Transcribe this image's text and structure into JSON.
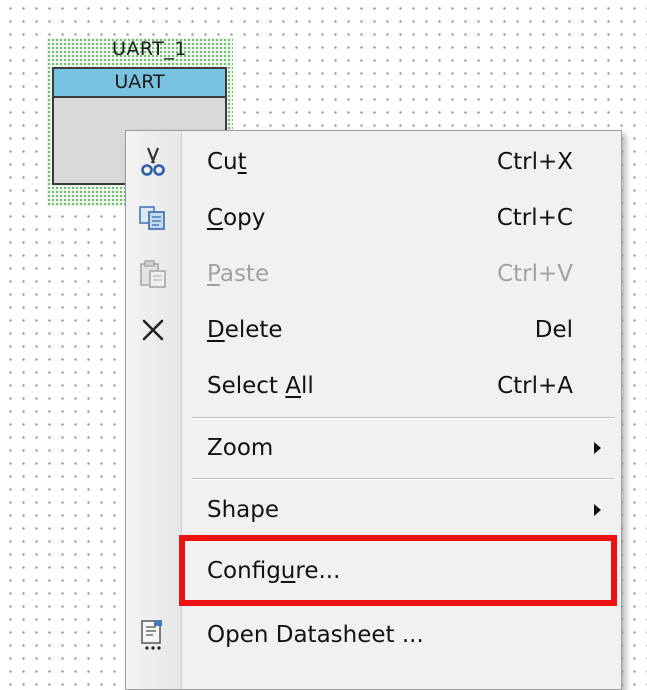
{
  "canvas": {
    "instance_name": "UART_1",
    "component_title": "UART"
  },
  "context_menu": {
    "items": [
      {
        "label_parts": [
          "Cu",
          "t",
          ""
        ],
        "shortcut": "Ctrl+X",
        "icon": "scissors-icon",
        "enabled": true
      },
      {
        "label_parts": [
          "",
          "C",
          "opy"
        ],
        "shortcut": "Ctrl+C",
        "icon": "copy-icon",
        "enabled": true
      },
      {
        "label_parts": [
          "",
          "P",
          "aste"
        ],
        "shortcut": "Ctrl+V",
        "icon": "paste-icon",
        "enabled": false
      },
      {
        "label_parts": [
          "",
          "D",
          "elete"
        ],
        "shortcut": "Del",
        "icon": "delete-x-icon",
        "enabled": true
      },
      {
        "label_parts": [
          "Select ",
          "A",
          "ll"
        ],
        "shortcut": "Ctrl+A",
        "icon": "",
        "enabled": true
      },
      {
        "label": "Zoom",
        "submenu": true
      },
      {
        "label": "Shape",
        "submenu": true
      },
      {
        "label_parts": [
          "Config",
          "u",
          "re..."
        ],
        "highlighted": true
      },
      {
        "label": "Open Datasheet ...",
        "icon": "datasheet-icon"
      }
    ],
    "highlight_color": "#ee1111"
  }
}
